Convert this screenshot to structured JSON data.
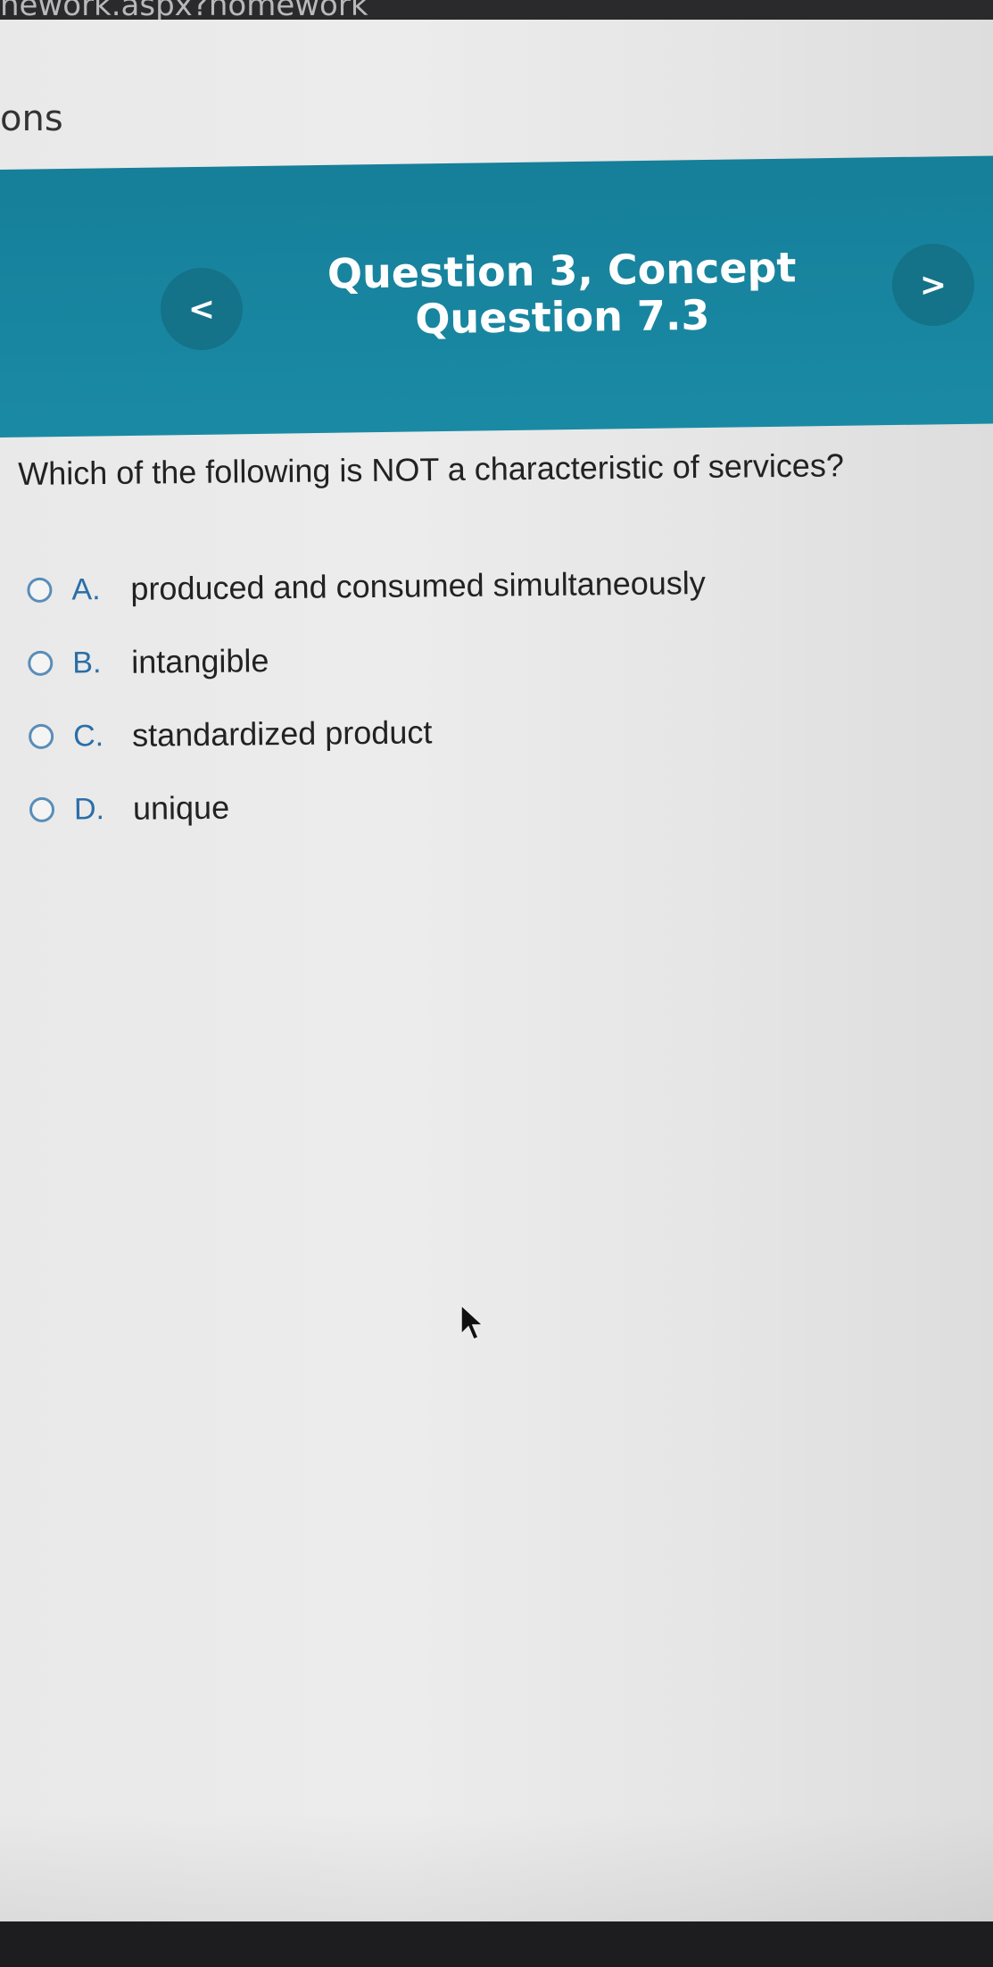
{
  "browser": {
    "url_fragment": "nework.aspx?homework"
  },
  "page": {
    "title": "ons"
  },
  "header": {
    "title_line1": "Question 3, Concept",
    "title_line2": "Question 7.3",
    "prev_label": "<",
    "next_label": ">",
    "accent_color": "#1a8aa4"
  },
  "question": {
    "text": "Which of the following is NOT a characteristic of services?",
    "options": [
      {
        "letter": "A.",
        "text": "produced and consumed simultaneously"
      },
      {
        "letter": "B.",
        "text": "intangible"
      },
      {
        "letter": "C.",
        "text": "standardized product"
      },
      {
        "letter": "D.",
        "text": "unique"
      }
    ]
  }
}
